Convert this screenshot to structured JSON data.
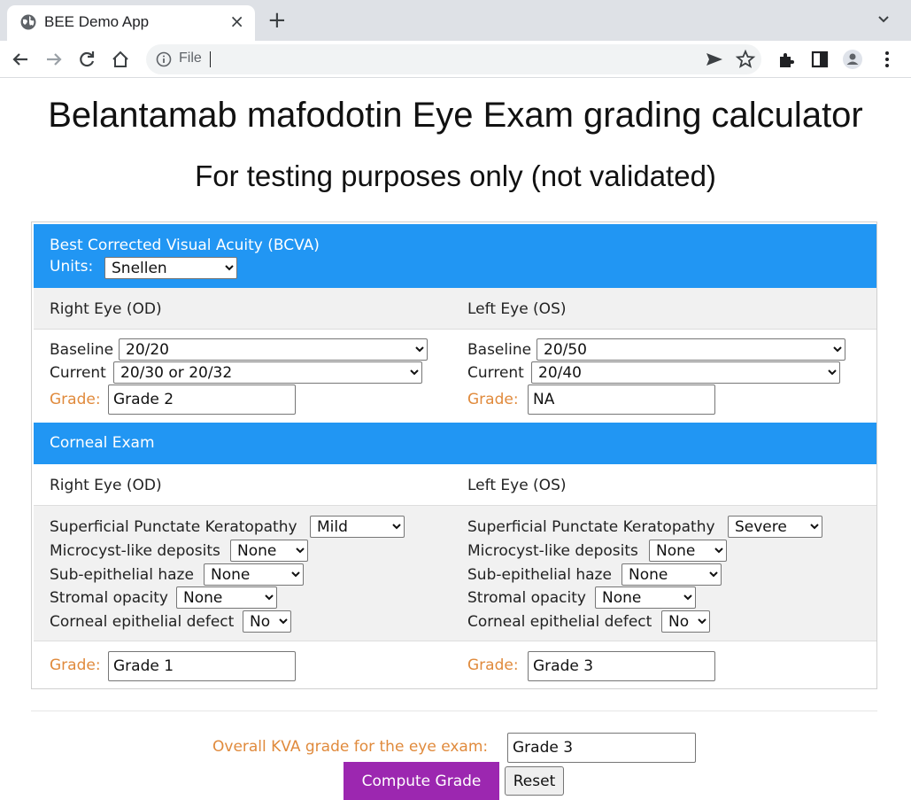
{
  "browser": {
    "tab_title": "BEE Demo App",
    "tab_close": "×",
    "new_tab": "+",
    "address": "File"
  },
  "page": {
    "title": "Belantamab mafodotin Eye Exam grading calculator",
    "subtitle": "For testing purposes only (not validated)"
  },
  "bcva": {
    "header": "Best Corrected Visual Acuity (BCVA)",
    "units_label": "Units:",
    "units_value": "Snellen",
    "right": {
      "heading": "Right Eye (OD)",
      "baseline_label": "Baseline",
      "baseline_value": "20/20",
      "current_label": "Current",
      "current_value": "20/30 or 20/32",
      "grade_label": "Grade:",
      "grade_value": "Grade 2"
    },
    "left": {
      "heading": "Left Eye (OS)",
      "baseline_label": "Baseline",
      "baseline_value": "20/50",
      "current_label": "Current",
      "current_value": "20/40",
      "grade_label": "Grade:",
      "grade_value": "NA"
    }
  },
  "corneal": {
    "header": "Corneal Exam",
    "right": {
      "heading": "Right Eye (OD)",
      "spk_label": "Superficial Punctate Keratopathy",
      "spk_value": "Mild",
      "micro_label": "Microcyst-like deposits",
      "micro_value": "None",
      "haze_label": "Sub-epithelial haze",
      "haze_value": "None",
      "stromal_label": "Stromal opacity",
      "stromal_value": "None",
      "defect_label": "Corneal epithelial defect",
      "defect_value": "No",
      "grade_label": "Grade:",
      "grade_value": "Grade 1"
    },
    "left": {
      "heading": "Left Eye (OS)",
      "spk_label": "Superficial Punctate Keratopathy",
      "spk_value": "Severe",
      "micro_label": "Microcyst-like deposits",
      "micro_value": "None",
      "haze_label": "Sub-epithelial haze",
      "haze_value": "None",
      "stromal_label": "Stromal opacity",
      "stromal_value": "None",
      "defect_label": "Corneal epithelial defect",
      "defect_value": "No",
      "grade_label": "Grade:",
      "grade_value": "Grade 3"
    }
  },
  "overall": {
    "label": "Overall KVA grade for the eye exam:",
    "value": "Grade 3"
  },
  "buttons": {
    "compute": "Compute Grade",
    "reset": "Reset"
  },
  "colors": {
    "section_header": "#2196f3",
    "grade_label": "#e08a3c",
    "compute_button": "#9c27b0"
  }
}
